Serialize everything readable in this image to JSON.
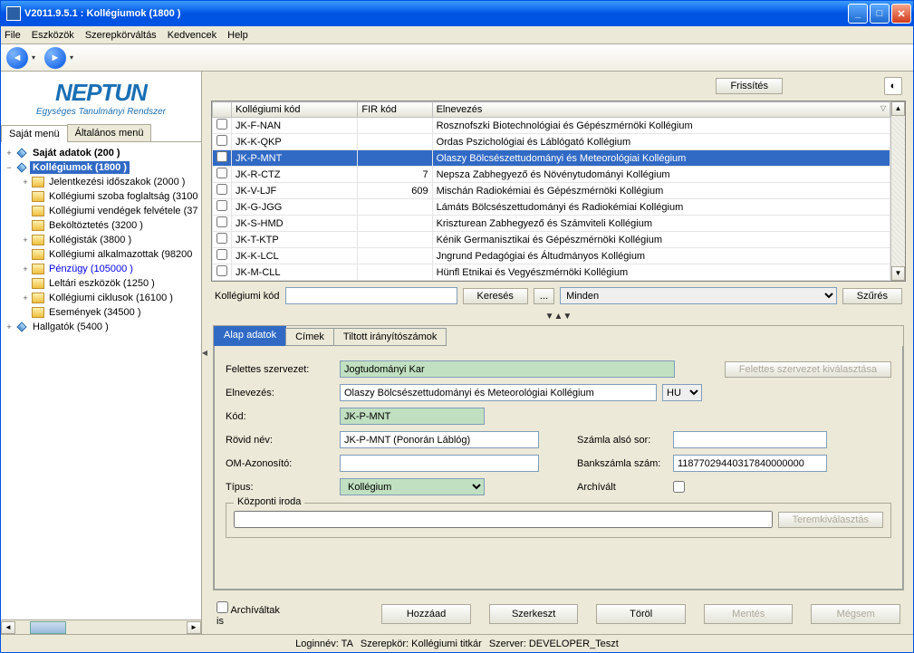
{
  "titlebar": {
    "title": "V2011.9.5.1 : Kollégiumok (1800  )"
  },
  "menubar": [
    "File",
    "Eszközök",
    "Szerepkörváltás",
    "Kedvencek",
    "Help"
  ],
  "logo": {
    "main": "NEPTUN",
    "sub": "Egységes Tanulmányi Rendszer"
  },
  "side_tabs": [
    "Saját menü",
    "Általános menü"
  ],
  "tree": [
    {
      "label": "Saját adatok (200  )",
      "level": 0,
      "icon": "diamond",
      "toggle": "+",
      "bold": true
    },
    {
      "label": "Kollégiumok (1800  )",
      "level": 0,
      "icon": "diamond",
      "toggle": "−",
      "bold": true,
      "selected": true
    },
    {
      "label": "Jelentkezési időszakok (2000  )",
      "level": 1,
      "icon": "folder",
      "toggle": "+"
    },
    {
      "label": "Kollégiumi szoba foglaltság (3100",
      "level": 1,
      "icon": "folder",
      "toggle": ""
    },
    {
      "label": "Kollégiumi vendégek felvétele (37",
      "level": 1,
      "icon": "folder",
      "toggle": ""
    },
    {
      "label": "Beköltöztetés (3200  )",
      "level": 1,
      "icon": "folder",
      "toggle": ""
    },
    {
      "label": "Kollégisták (3800  )",
      "level": 1,
      "icon": "folder",
      "toggle": "+"
    },
    {
      "label": "Kollégiumi alkalmazottak (98200",
      "level": 1,
      "icon": "folder",
      "toggle": ""
    },
    {
      "label": "Pénzügy (105000  )",
      "level": 1,
      "icon": "folder",
      "toggle": "+",
      "blue": true
    },
    {
      "label": "Leltári eszközök (1250  )",
      "level": 1,
      "icon": "folder",
      "toggle": ""
    },
    {
      "label": "Kollégiumi ciklusok (16100  )",
      "level": 1,
      "icon": "folder",
      "toggle": "+"
    },
    {
      "label": "Események (34500  )",
      "level": 1,
      "icon": "folder",
      "toggle": ""
    },
    {
      "label": "Hallgatók (5400  )",
      "level": 0,
      "icon": "diamond",
      "toggle": "+"
    }
  ],
  "top_buttons": {
    "refresh": "Frissítés"
  },
  "grid": {
    "headers": [
      "",
      "Kollégiumi kód",
      "FIR kód",
      "Elnevezés"
    ],
    "sort_col": 3,
    "rows": [
      {
        "code": "JK-F-NAN",
        "fir": "",
        "name": "Rosznofszki Biotechnológiai és Gépészmérnöki Kollégium"
      },
      {
        "code": "JK-K-QKP",
        "fir": "",
        "name": "Ordas Pszichológiai és Láblógató Kollégium"
      },
      {
        "code": "JK-P-MNT",
        "fir": "",
        "name": "Olaszy Bölcsészettudományi és Meteorológiai Kollégium",
        "selected": true
      },
      {
        "code": "JK-R-CTZ",
        "fir": "7",
        "name": "Nepsza Zabhegyező és Növénytudományi Kollégium"
      },
      {
        "code": "JK-V-LJF",
        "fir": "609",
        "name": "Mischán Radiokémiai és Gépészmérnöki Kollégium"
      },
      {
        "code": "JK-G-JGG",
        "fir": "",
        "name": "Lámáts Bölcsészettudományi és Radiokémiai Kollégium"
      },
      {
        "code": "JK-S-HMD",
        "fir": "",
        "name": "Kriszturean Zabhegyező és Számviteli Kollégium"
      },
      {
        "code": "JK-T-KTP",
        "fir": "",
        "name": "Kénik Germanisztikai és Gépészmérnöki Kollégium"
      },
      {
        "code": "JK-K-LCL",
        "fir": "",
        "name": "Jngrund Pedagógiai és Áltudmányos Kollégium"
      },
      {
        "code": "JK-M-CLL",
        "fir": "",
        "name": "Hünfl Etnikai és Vegyészmérnöki Kollégium"
      }
    ]
  },
  "search": {
    "label": "Kollégiumi kód",
    "value": "",
    "search_btn": "Keresés",
    "more_btn": "...",
    "scope": "Minden",
    "filter_btn": "Szűrés"
  },
  "detail_tabs": [
    "Alap adatok",
    "Címek",
    "Tiltott irányítószámok"
  ],
  "form": {
    "felettes_label": "Felettes szervezet:",
    "felettes_value": "Jogtudományi Kar",
    "felettes_btn": "Felettes szervezet kiválasztása",
    "elnevezes_label": "Elnevezés:",
    "elnevezes_value": "Olaszy Bölcsészettudományi és Meteorológiai Kollégium",
    "lang": "HU",
    "kod_label": "Kód:",
    "kod_value": "JK-P-MNT",
    "rovid_label": "Rövid név:",
    "rovid_value": "JK-P-MNT (Ponorán Láblóg)",
    "szamla_label": "Számla alsó sor:",
    "szamla_value": "",
    "om_label": "OM-Azonosító:",
    "om_value": "",
    "bank_label": "Bankszámla szám:",
    "bank_value": "11877029440317840000000",
    "tipus_label": "Típus:",
    "tipus_value": "Kollégium",
    "archivalt_label": "Archívált",
    "kozponti_label": "Központi iroda",
    "kozponti_value": "",
    "terem_btn": "Teremkiválasztás"
  },
  "bottom": {
    "archive_chk": "Archíváltak is",
    "add": "Hozzáad",
    "edit": "Szerkeszt",
    "delete": "Töröl",
    "save": "Mentés",
    "cancel": "Mégsem"
  },
  "status": {
    "login": "Loginnév: TA",
    "role": "Szerepkör: Kollégiumi titkár",
    "server": "Szerver: DEVELOPER_Teszt"
  }
}
